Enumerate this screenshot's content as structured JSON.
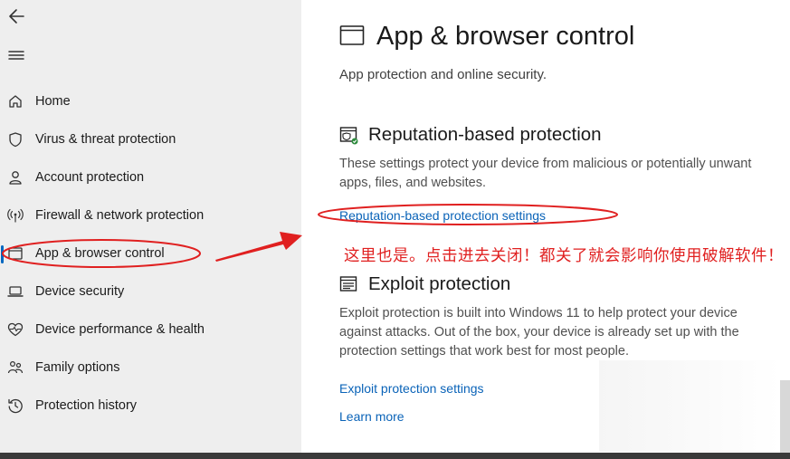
{
  "sidebar": {
    "items": [
      {
        "label": "Home",
        "icon": "home-icon"
      },
      {
        "label": "Virus & threat protection",
        "icon": "shield-icon"
      },
      {
        "label": "Account protection",
        "icon": "person-icon"
      },
      {
        "label": "Firewall & network protection",
        "icon": "antenna-icon"
      },
      {
        "label": "App & browser control",
        "icon": "app-window-icon",
        "active": true
      },
      {
        "label": "Device security",
        "icon": "laptop-icon"
      },
      {
        "label": "Device performance & health",
        "icon": "heart-icon"
      },
      {
        "label": "Family options",
        "icon": "family-icon"
      },
      {
        "label": "Protection history",
        "icon": "history-icon"
      }
    ]
  },
  "main": {
    "title": "App & browser control",
    "subtitle": "App protection and online security.",
    "reputation": {
      "title": "Reputation-based protection",
      "desc_line1": "These settings protect your device from malicious or potentially unwant",
      "desc_line2": "apps, files, and websites.",
      "link": "Reputation-based protection settings"
    },
    "exploit": {
      "title": "Exploit protection",
      "desc_line1": "Exploit protection is built into Windows 11 to help protect your device",
      "desc_line2": "against attacks.  Out of the box, your device is already set up with the",
      "desc_line3": "protection settings that work best for most people.",
      "link": "Exploit protection settings",
      "learn_more": "Learn more"
    }
  },
  "annotation": {
    "text": "这里也是。点击进去关闭！都关了就会影响你使用破解软件！",
    "color": "#e02020"
  },
  "colors": {
    "sidebar_bg": "#eeeeee",
    "link": "#0a63b8",
    "accent": "#0067c0"
  }
}
